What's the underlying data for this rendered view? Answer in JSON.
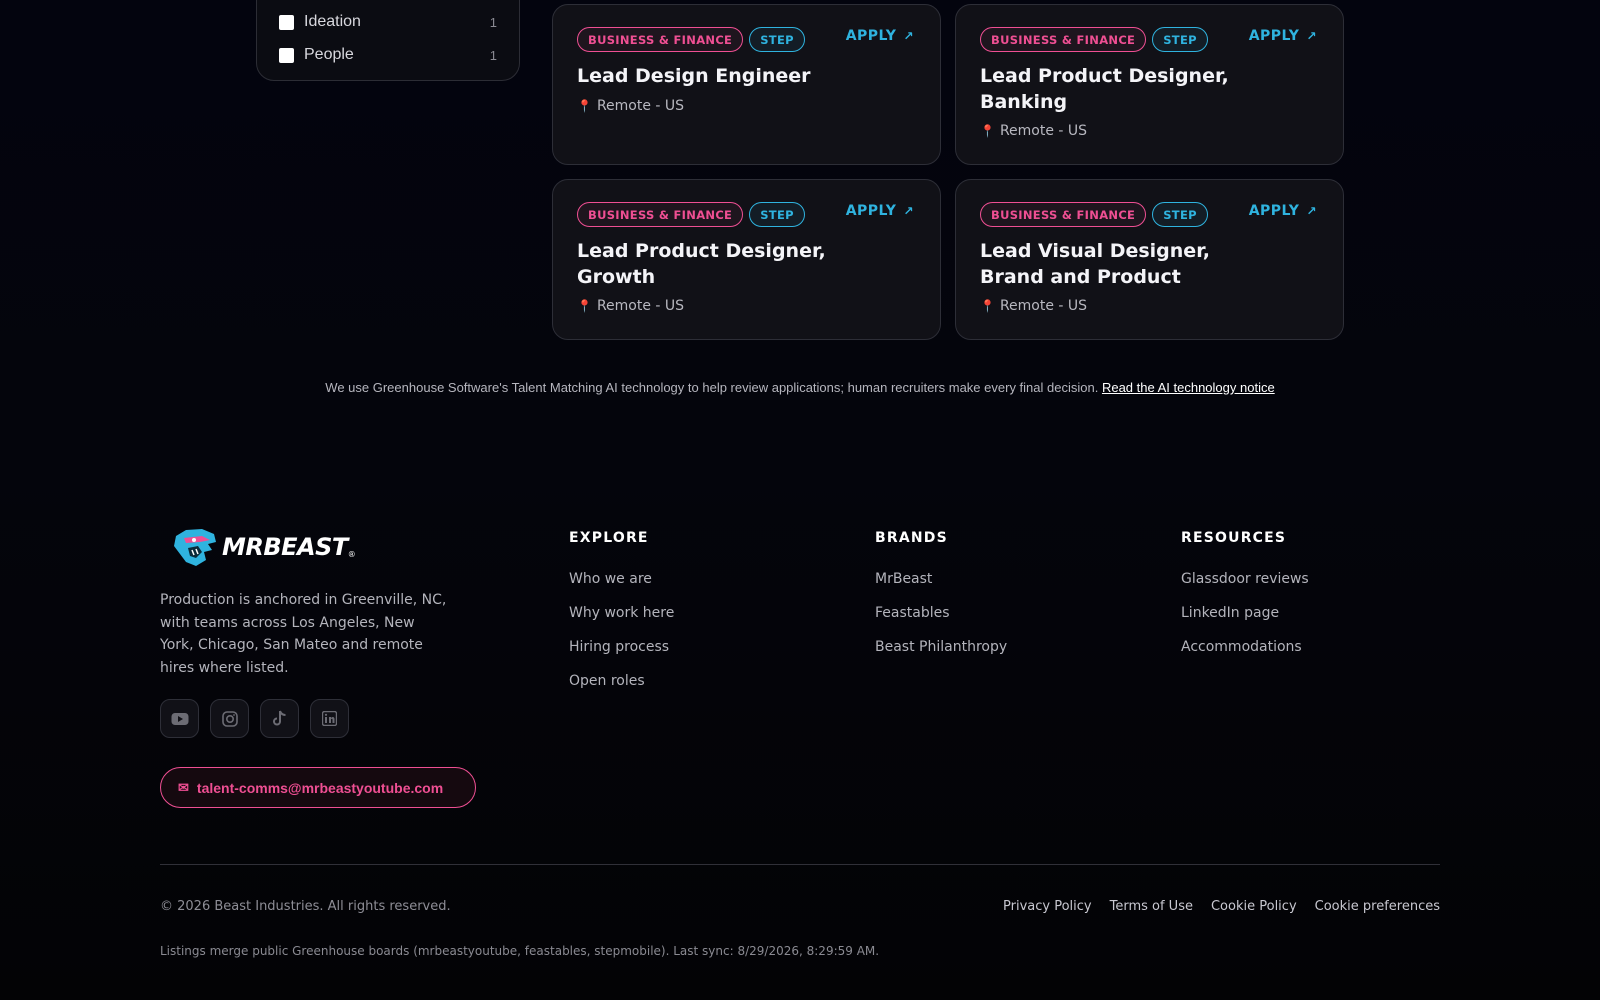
{
  "filters": [
    {
      "label": "Ideation",
      "count": "1"
    },
    {
      "label": "People",
      "count": "1"
    }
  ],
  "jobs": [
    {
      "tags": [
        "BUSINESS & FINANCE",
        "STEP"
      ],
      "apply": "APPLY",
      "title": "Lead Design Engineer",
      "location": "Remote - US"
    },
    {
      "tags": [
        "BUSINESS & FINANCE",
        "STEP"
      ],
      "apply": "APPLY",
      "title": "Lead Product Designer, Banking",
      "location": "Remote - US"
    },
    {
      "tags": [
        "BUSINESS & FINANCE",
        "STEP"
      ],
      "apply": "APPLY",
      "title": "Lead Product Designer, Growth",
      "location": "Remote - US"
    },
    {
      "tags": [
        "BUSINESS & FINANCE",
        "STEP"
      ],
      "apply": "APPLY",
      "title": "Lead Visual Designer, Brand and Product",
      "location": "Remote - US"
    }
  ],
  "notice": {
    "text": "We use Greenhouse Software's Talent Matching AI technology to help review applications; human recruiters make every final decision.",
    "link": "Read the AI technology notice"
  },
  "footer": {
    "logo_text": "MRBEAST",
    "logo_reg": "®",
    "about": "Production is anchored in Greenville, NC, with teams across Los Angeles, New York, Chicago, San Mateo and remote hires where listed.",
    "socials": [
      "youtube-icon",
      "instagram-icon",
      "tiktok-icon",
      "linkedin-icon"
    ],
    "email": "talent-comms@mrbeastyoutube.com",
    "columns": [
      {
        "heading": "EXPLORE",
        "links": [
          "Who we are",
          "Why work here",
          "Hiring process",
          "Open roles"
        ]
      },
      {
        "heading": "BRANDS",
        "links": [
          "MrBeast",
          "Feastables",
          "Beast Philanthropy"
        ]
      },
      {
        "heading": "RESOURCES",
        "links": [
          "Glassdoor reviews",
          "LinkedIn page",
          "Accommodations"
        ]
      }
    ],
    "copyright": "© 2026 Beast Industries. All rights reserved.",
    "legal": [
      "Privacy Policy",
      "Terms of Use",
      "Cookie Policy",
      "Cookie preferences"
    ],
    "sync": "Listings merge public Greenhouse boards (mrbeastyoutube, feastables, stepmobile). Last sync: 8/29/2026, 8:29:59 AM."
  },
  "colors": {
    "accent_pink": "#ef4f93",
    "accent_blue": "#2fb3df",
    "background": "#03040c"
  }
}
